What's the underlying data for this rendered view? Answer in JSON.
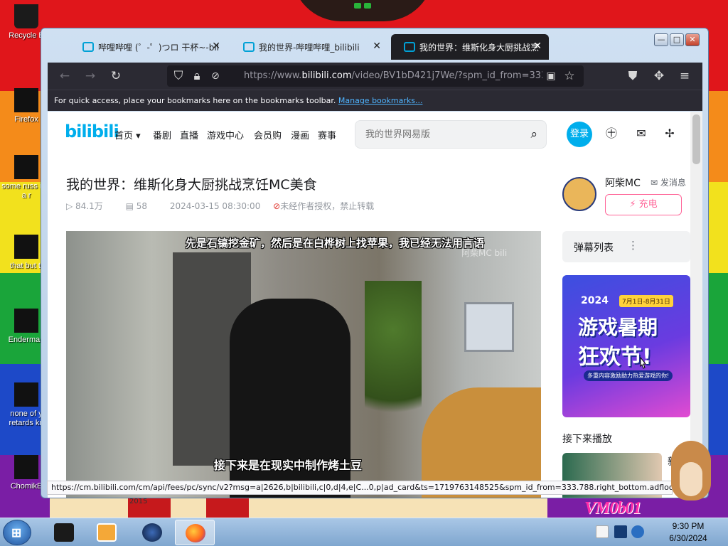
{
  "desktop": {
    "icons": [
      {
        "label": "Recycle B"
      },
      {
        "label": "Firefox"
      },
      {
        "label": "some russ ran a r"
      },
      {
        "label": "that but tt"
      },
      {
        "label": "Enderman"
      },
      {
        "label": "none of y retards kn"
      },
      {
        "label": "ChomikB"
      }
    ],
    "wallpaper_text": "VM0b01",
    "partial_label": "2015"
  },
  "window": {
    "tabs": [
      {
        "title": "哔哩哔哩 (゜-゜)つロ 干杯~-bil",
        "active": false
      },
      {
        "title": "我的世界-哔哩哔哩_bilibili",
        "active": false
      },
      {
        "title": "我的世界：维斯化身大厨挑战烹",
        "active": true
      }
    ],
    "controls": {
      "minimize": "—",
      "maximize": "□",
      "close": "✕"
    }
  },
  "browser": {
    "url_prefix": "https://www.",
    "url_domain": "bilibili.com",
    "url_rest": "/video/BV1bD421j7We/?spm_id_from=333.7",
    "bookmarks_text": "For quick access, place your bookmarks here on the bookmarks toolbar.",
    "bookmarks_link": "Manage bookmarks...",
    "status_url": "https://cm.bilibili.com/cm/api/fees/pc/sync/v2?msg=a|2626,b|bilibili,c|0,d|4,e|C...0,p|ad_card&ts=1719763148525&spm_id_from=333.788.right_bottom.adfloor-2626"
  },
  "site": {
    "logo": "bilibili",
    "nav": [
      "首页",
      "番剧",
      "直播",
      "游戏中心",
      "会员购",
      "漫画",
      "赛事"
    ],
    "search_placeholder": "我的世界网易版",
    "login": "登录"
  },
  "video": {
    "title": "我的世界：维斯化身大厨挑战烹饪MC美食",
    "views": "84.1万",
    "danmaku_count": "58",
    "date": "2024-03-15 08:30:00",
    "notice": "未经作者授权，禁止转载",
    "subtitle_top": "先是石镐挖金矿，然后是在白桦树上找苹果，我已经无法用言语",
    "subtitle_bottom": "接下来是在现实中制作烤土豆",
    "watermark": "阿柴MC  bili"
  },
  "sidebar": {
    "up_name": "阿柴MC",
    "send_message": "发消息",
    "charge": "充电",
    "danmaku_list": "弹幕列表",
    "ad": {
      "year": "2024",
      "dates": "7月1日-8月31日",
      "line1": "游戏暑期",
      "line2": "狂欢节!",
      "tagline": "多重内容激励助力热爱游戏的你!"
    },
    "next_up": "接下来播放",
    "next_item_text": "新"
  },
  "taskbar": {
    "time": "9:30 PM",
    "date": "6/30/2024"
  },
  "colors": {
    "bilibili_blue": "#00aeec",
    "bilibili_pink": "#ff6699",
    "browser_dark": "#2b2a33"
  }
}
